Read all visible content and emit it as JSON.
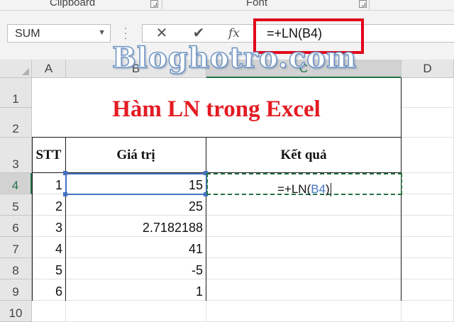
{
  "ribbon": {
    "groups": [
      "Clipboard",
      "Font"
    ]
  },
  "formula_bar": {
    "name_box": "SUM",
    "formula": "=+LN(B4)",
    "cancel_icon": "cancel-x-icon",
    "enter_icon": "checkmark-icon",
    "fx_label": "fx"
  },
  "watermark": "Bloghotro.com",
  "columns": [
    "A",
    "B",
    "C",
    "D"
  ],
  "rows": [
    "1",
    "2",
    "3",
    "4",
    "5",
    "6",
    "7",
    "8",
    "9",
    "10"
  ],
  "sheet": {
    "title": "Hàm LN trong Excel",
    "headers": {
      "stt": "STT",
      "value": "Giá trị",
      "result": "Kết quả"
    },
    "data": [
      {
        "stt": "1",
        "value": "15"
      },
      {
        "stt": "2",
        "value": "25"
      },
      {
        "stt": "3",
        "value": "2.7182188"
      },
      {
        "stt": "4",
        "value": "41"
      },
      {
        "stt": "5",
        "value": "-5"
      },
      {
        "stt": "6",
        "value": "1"
      }
    ],
    "editing_cell": {
      "prefix": "=+LN(",
      "ref": "B4",
      "suffix": ")"
    }
  },
  "colors": {
    "title_red": "#e31b23",
    "highlight_box": "#e2061a",
    "excel_green": "#217346",
    "reference_blue": "#4472c4"
  }
}
